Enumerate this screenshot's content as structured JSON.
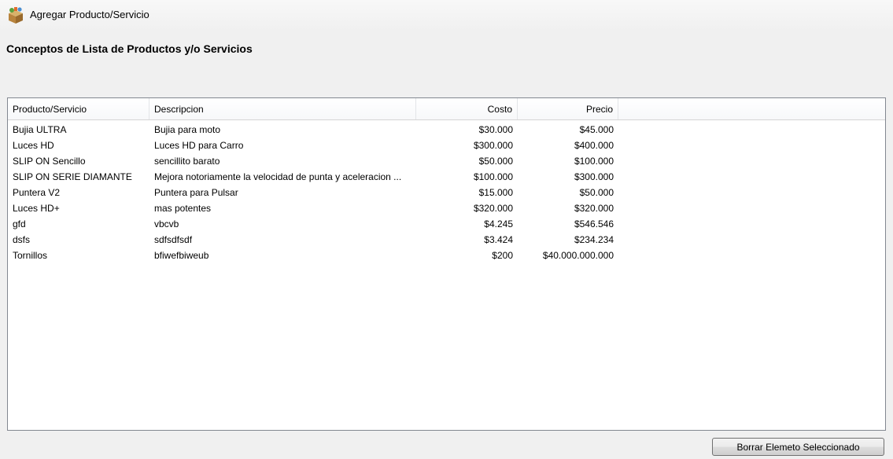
{
  "window": {
    "title": "Agregar Producto/Servicio",
    "icon": "product-box-icon"
  },
  "heading": "Conceptos de Lista de Productos y/o Servicios",
  "table": {
    "columns": [
      "Producto/Servicio",
      "Descripcion",
      "Costo",
      "Precio"
    ],
    "rows": [
      [
        "Bujia ULTRA",
        "Bujia para moto",
        "$30.000",
        "$45.000"
      ],
      [
        "Luces HD",
        "Luces HD para Carro",
        "$300.000",
        "$400.000"
      ],
      [
        "SLIP ON Sencillo",
        "sencillito barato",
        "$50.000",
        "$100.000"
      ],
      [
        "SLIP ON SERIE DIAMANTE",
        "Mejora notoriamente la velocidad de punta y aceleracion ...",
        "$100.000",
        "$300.000"
      ],
      [
        "Puntera V2",
        "Puntera para Pulsar",
        "$15.000",
        "$50.000"
      ],
      [
        "Luces HD+",
        "mas potentes",
        "$320.000",
        "$320.000"
      ],
      [
        "gfd",
        "vbcvb",
        "$4.245",
        "$546.546"
      ],
      [
        "dsfs",
        "sdfsdfsdf",
        "$3.424",
        "$234.234"
      ],
      [
        "Tornillos",
        "bfiwefbiweub",
        "$200",
        "$40.000.000.000"
      ]
    ]
  },
  "buttons": {
    "delete_selected": "Borrar Elemeto Seleccionado"
  }
}
